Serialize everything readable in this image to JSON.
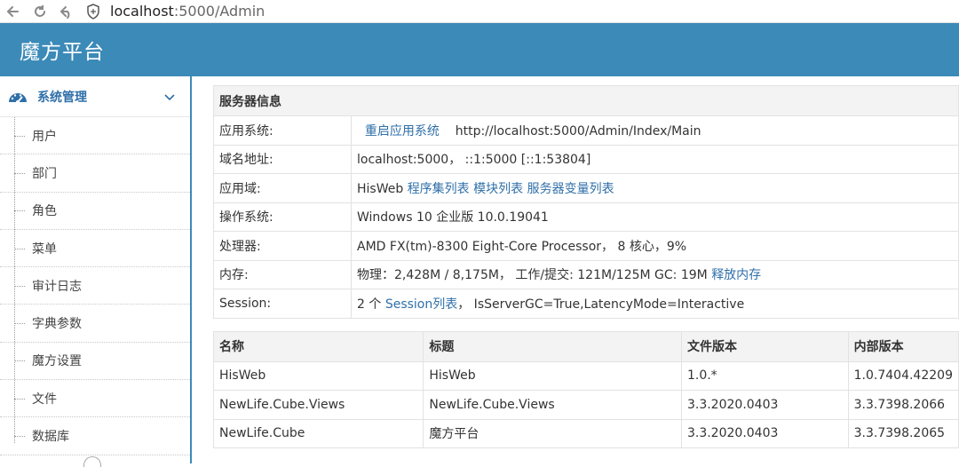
{
  "browser": {
    "url_host": "localhost",
    "url_path": ":5000/Admin"
  },
  "app": {
    "title": "魔方平台"
  },
  "sidebar": {
    "section_label": "系统管理",
    "items": [
      {
        "label": "用户"
      },
      {
        "label": "部门"
      },
      {
        "label": "角色"
      },
      {
        "label": "菜单"
      },
      {
        "label": "审计日志"
      },
      {
        "label": "字典参数"
      },
      {
        "label": "魔方设置"
      },
      {
        "label": "文件"
      },
      {
        "label": "数据库"
      }
    ]
  },
  "server_info": {
    "header": "服务器信息",
    "app_system": {
      "key": "应用系统:",
      "restart_link": "重启应用系统",
      "url": "http://localhost:5000/Admin/Index/Main"
    },
    "domain": {
      "key": "域名地址:",
      "value": "localhost:5000， ::1:5000  [::1:53804]"
    },
    "app_domain": {
      "key": "应用域:",
      "name": "HisWeb",
      "link1": "程序集列表",
      "link2": "模块列表",
      "link3": "服务器变量列表"
    },
    "os": {
      "key": "操作系统:",
      "value": "Windows 10 企业版 10.0.19041"
    },
    "cpu": {
      "key": "处理器:",
      "value": "AMD FX(tm)-8300 Eight-Core Processor， 8 核心，9%"
    },
    "memory": {
      "key": "内存:",
      "value": "物理：2,428M / 8,175M， 工作/提交: 121M/125M GC: 19M",
      "link": "释放内存"
    },
    "session": {
      "key": "Session:",
      "count": "2 个",
      "link": "Session列表",
      "value": "， IsServerGC=True,LatencyMode=Interactive"
    }
  },
  "versions": {
    "columns": [
      "名称",
      "标题",
      "文件版本",
      "内部版本"
    ],
    "rows": [
      [
        "HisWeb",
        "HisWeb",
        "1.0.*",
        "1.0.7404.42209"
      ],
      [
        "NewLife.Cube.Views",
        "NewLife.Cube.Views",
        "3.3.2020.0403",
        "3.3.7398.2066"
      ],
      [
        "NewLife.Cube",
        "魔方平台",
        "3.3.2020.0403",
        "3.3.7398.2065"
      ]
    ]
  },
  "colors": {
    "header": "#3b8ab8",
    "link": "#2f6fa8"
  }
}
